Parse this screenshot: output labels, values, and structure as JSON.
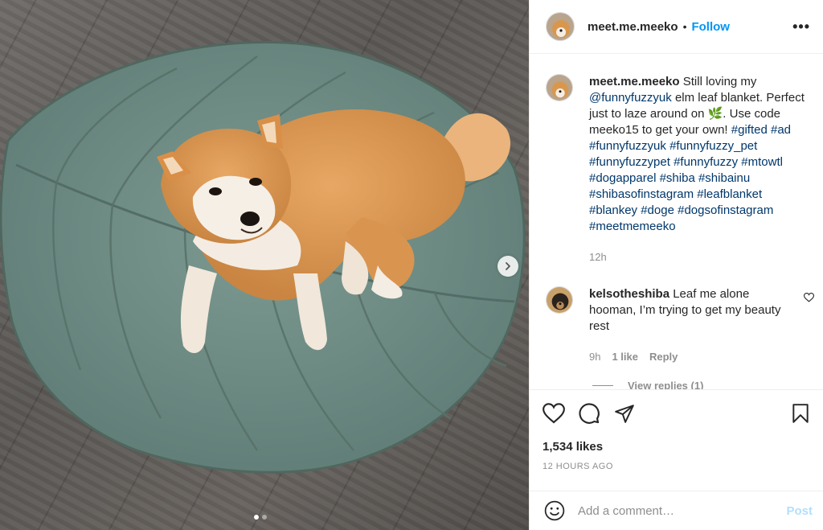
{
  "post": {
    "username": "meet.me.meeko",
    "dot": "•",
    "follow_label": "Follow",
    "more_label": "•••"
  },
  "caption": {
    "username": "meet.me.meeko",
    "text_1": " Still loving my ",
    "mention": "@funnyfuzzyuk",
    "text_2": " elm leaf blanket. Perfect just to laze around on ",
    "emoji": "🌿",
    "text_3": ". Use code meeko15 to get your own! ",
    "hashtags": [
      "#gifted",
      "#ad",
      "#funnyfuzzyuk",
      "#funnyfuzzy_pet",
      "#funnyfuzzypet",
      "#funnyfuzzy",
      "#mtowtl",
      "#dogapparel",
      "#shiba",
      "#shibainu",
      "#shibasofinstagram",
      "#leafblanket",
      "#blankey",
      "#doge",
      "#dogsofinstagram",
      "#meetmemeeko"
    ],
    "time": "12h"
  },
  "comment": {
    "username": "kelsotheshiba",
    "text": " Leaf me alone hooman, I’m trying to get my beauty rest",
    "time": "9h",
    "likes": "1 like",
    "reply_label": "Reply",
    "view_replies": "View replies (1)"
  },
  "actions": {
    "likes": "1,534 likes",
    "time_ago": "12 HOURS AGO"
  },
  "add_comment": {
    "placeholder": "Add a comment…",
    "post_label": "Post"
  },
  "carousel": {
    "slide_count": 2,
    "active_slide": 1
  },
  "colors": {
    "accent": "#0095f6",
    "link": "#00376b",
    "muted": "#8e8e8e",
    "post_disabled": "#b2dffc"
  }
}
